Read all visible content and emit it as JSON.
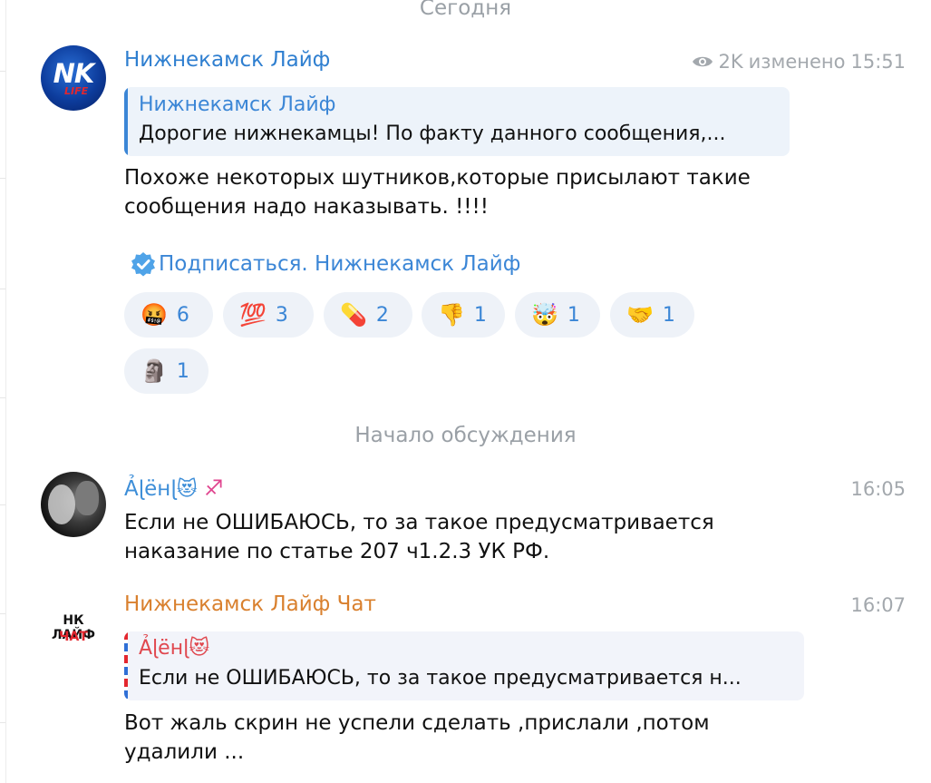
{
  "date_separator": "Сегодня",
  "discussion_separator": "Начало обсуждения",
  "post": {
    "author": "Нижнекамск Лайф",
    "views": "2K",
    "edited_label": "изменено",
    "time": "15:51",
    "avatar_text": "NK",
    "avatar_subtext": "LIFE",
    "reply": {
      "author": "Нижнекамск Лайф",
      "text": "Дорогие нижнекамцы!  По факту данного сообщения,..."
    },
    "text": "Похоже некоторых шутников,которые присылают такие\nсообщения надо наказывать.  !!!!",
    "subscribe_label": "Подписаться. Нижнекамск Лайф",
    "reactions": [
      {
        "emoji": "🤬",
        "count": "6"
      },
      {
        "emoji": "💯",
        "count": "3"
      },
      {
        "emoji": "💊",
        "count": "2"
      },
      {
        "emoji": "👎",
        "count": "1"
      },
      {
        "emoji": "🤯",
        "count": "1"
      },
      {
        "emoji": "🤝",
        "count": "1"
      },
      {
        "emoji": "🗿",
        "count": "1"
      }
    ]
  },
  "comments": [
    {
      "author": "Ảɭёнɭ",
      "author_emoji": "😻",
      "author_sign": "♐",
      "time": "16:05",
      "text": "Если не ОШИБАЮСЬ, то за такое предусматривается\nнаказание по статье 207 ч1.2.3  УК РФ."
    },
    {
      "author": "Нижнекамск Лайф Чат",
      "avatar_line1": "НК ЛАЙФ",
      "avatar_line2": "ЧАТ",
      "time": "16:07",
      "reply": {
        "author": "Ảɭёнɭ",
        "author_emoji": "😻",
        "text": "Если не ОШИБАЮСЬ, то за такое предусматривается н..."
      },
      "text": "Вот жаль скрин не успели сделать ,прислали ,потом\nудалили ..."
    }
  ]
}
